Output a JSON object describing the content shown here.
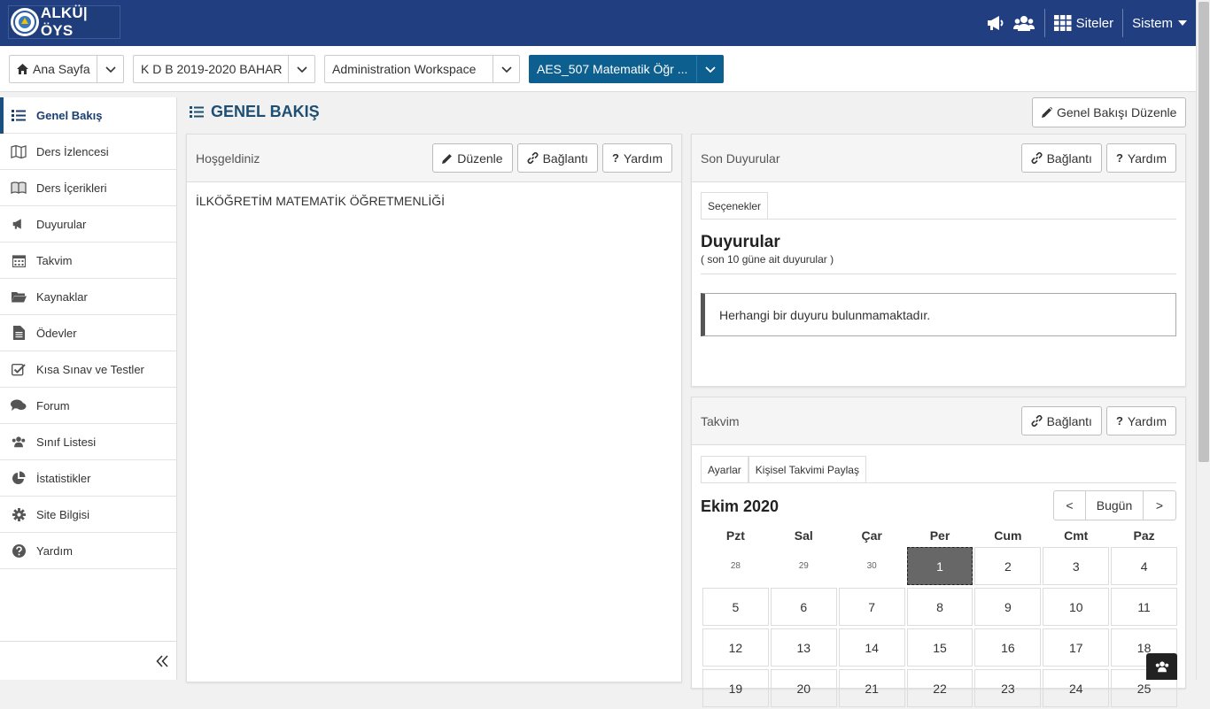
{
  "header": {
    "logo_text": "ALKÜ|ÖYS",
    "sites_label": "Siteler",
    "system_label": "Sistem"
  },
  "breadcrumbs": [
    {
      "label": "Ana Sayfa"
    },
    {
      "label": "K D B 2019-2020 BAHAR"
    },
    {
      "label": "Administration Workspace"
    },
    {
      "label": "AES_507 Matematik Öğr ..."
    }
  ],
  "sidebar": {
    "items": [
      {
        "label": "Genel Bakış",
        "icon": "list-icon"
      },
      {
        "label": "Ders İzlencesi",
        "icon": "map-icon"
      },
      {
        "label": "Ders İçerikleri",
        "icon": "book-icon"
      },
      {
        "label": "Duyurular",
        "icon": "bullhorn-icon"
      },
      {
        "label": "Takvim",
        "icon": "calendar-icon"
      },
      {
        "label": "Kaynaklar",
        "icon": "folder-icon"
      },
      {
        "label": "Ödevler",
        "icon": "document-icon"
      },
      {
        "label": "Kısa Sınav ve Testler",
        "icon": "checkbox-icon"
      },
      {
        "label": "Forum",
        "icon": "comments-icon"
      },
      {
        "label": "Sınıf Listesi",
        "icon": "users-icon"
      },
      {
        "label": "İstatistikler",
        "icon": "pie-chart-icon"
      },
      {
        "label": "Site Bilgisi",
        "icon": "gear-icon"
      },
      {
        "label": "Yardım",
        "icon": "question-icon"
      }
    ]
  },
  "main": {
    "title": "GENEL BAKIŞ",
    "edit_overview_label": "Genel Bakışı Düzenle"
  },
  "welcome_panel": {
    "title": "Hoşgeldiniz",
    "edit_label": "Düzenle",
    "link_label": "Bağlantı",
    "help_label": "Yardım",
    "content": "İLKÖĞRETİM MATEMATİK ÖĞRETMENLİĞİ"
  },
  "announcements_panel": {
    "title": "Son Duyurular",
    "link_label": "Bağlantı",
    "help_label": "Yardım",
    "options_tab": "Seçenekler",
    "heading": "Duyurular",
    "subheading": "( son 10 güne ait duyurular )",
    "empty_message": "Herhangi bir duyuru bulunmamaktadır."
  },
  "calendar_panel": {
    "title": "Takvim",
    "link_label": "Bağlantı",
    "help_label": "Yardım",
    "settings_tab": "Ayarlar",
    "share_tab": "Kişisel Takvimi Paylaş",
    "month_title": "Ekim 2020",
    "prev_label": "<",
    "today_label": "Bugün",
    "next_label": ">",
    "weekdays": [
      "Pzt",
      "Sal",
      "Çar",
      "Per",
      "Cum",
      "Cmt",
      "Paz"
    ],
    "weeks": [
      [
        "28",
        "29",
        "30",
        "1",
        "2",
        "3",
        "4"
      ],
      [
        "5",
        "6",
        "7",
        "8",
        "9",
        "10",
        "11"
      ],
      [
        "12",
        "13",
        "14",
        "15",
        "16",
        "17",
        "18"
      ],
      [
        "19",
        "20",
        "21",
        "22",
        "23",
        "24",
        "25"
      ]
    ],
    "today": "1"
  }
}
